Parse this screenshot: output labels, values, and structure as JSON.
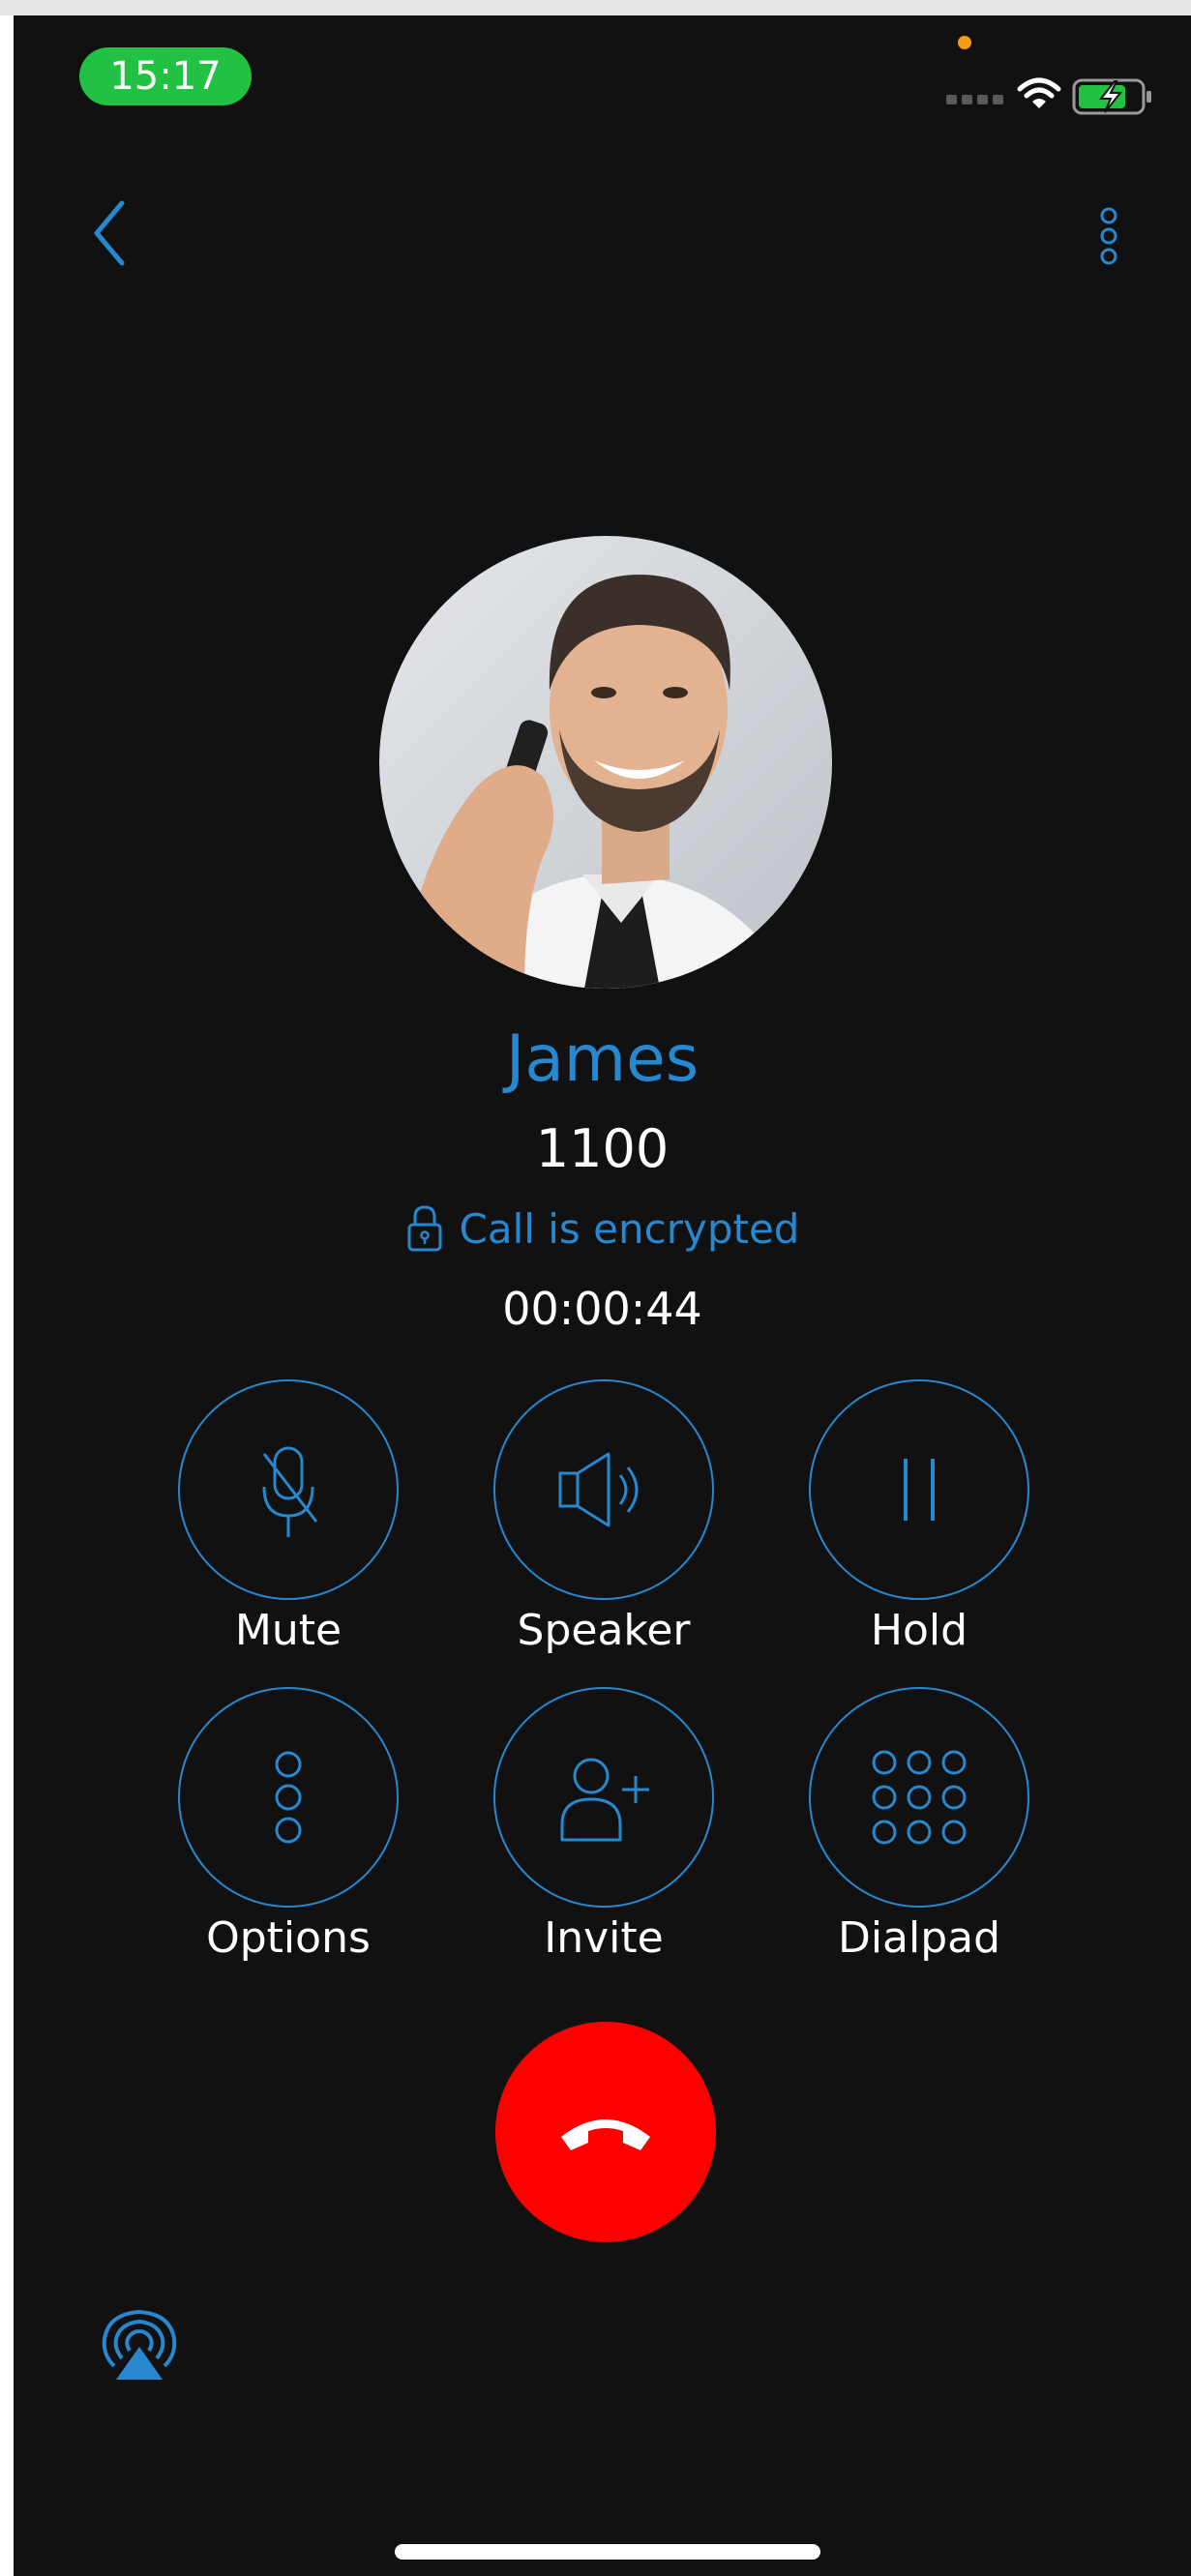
{
  "status_bar": {
    "time": "15:17",
    "colors": {
      "time_pill": "#21c144",
      "recording_dot": "#f39c12",
      "battery": "#21c144"
    },
    "icons": [
      "signal-icon",
      "wifi-icon",
      "battery-charging-icon"
    ]
  },
  "nav": {
    "icons": {
      "back": "chevron-left-icon",
      "more": "vertical-ellipsis-icon"
    }
  },
  "contact": {
    "name": "James",
    "number": "1100",
    "encryption_status": "Call is encrypted",
    "call_duration": "00:00:44"
  },
  "controls": [
    {
      "id": "mute",
      "label": "Mute",
      "icon": "microphone-off-icon"
    },
    {
      "id": "speaker",
      "label": "Speaker",
      "icon": "speaker-icon"
    },
    {
      "id": "hold",
      "label": "Hold",
      "icon": "pause-icon"
    },
    {
      "id": "options",
      "label": "Options",
      "icon": "vertical-dots-icon"
    },
    {
      "id": "invite",
      "label": "Invite",
      "icon": "add-user-icon"
    },
    {
      "id": "dialpad",
      "label": "Dialpad",
      "icon": "dialpad-icon"
    }
  ],
  "end_call": {
    "icon": "hang-up-icon",
    "color": "#fe0000"
  },
  "audio_route": {
    "icon": "airplay-icon"
  },
  "theme": {
    "accent": "#2788cf",
    "background": "#111111",
    "text": "#ffffff"
  }
}
